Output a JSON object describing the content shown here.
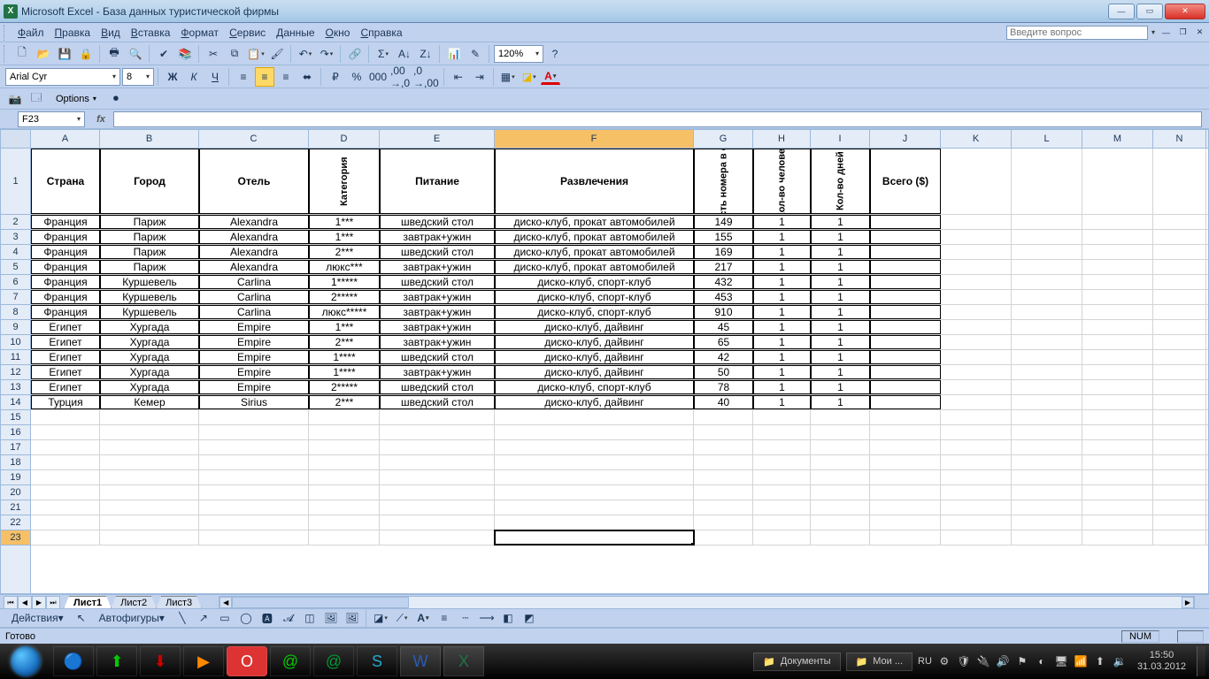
{
  "window": {
    "title": "Microsoft Excel - База данных туристической фирмы"
  },
  "menu": {
    "items": [
      "Файл",
      "Правка",
      "Вид",
      "Вставка",
      "Формат",
      "Сервис",
      "Данные",
      "Окно",
      "Справка"
    ],
    "ask_placeholder": "Введите вопрос"
  },
  "toolbar": {
    "zoom": "120%",
    "font_name": "Arial Cyr",
    "font_size": "8",
    "options_label": "Options"
  },
  "namebox": {
    "ref": "F23",
    "fx": "fx"
  },
  "columns": {
    "letters": [
      "A",
      "B",
      "C",
      "D",
      "E",
      "F",
      "G",
      "H",
      "I",
      "J",
      "K",
      "L",
      "M",
      "N"
    ],
    "widths": [
      78,
      112,
      124,
      80,
      130,
      225,
      67,
      65,
      67,
      80,
      80,
      80,
      80,
      60
    ],
    "selectedIndex": 5
  },
  "headers": [
    "Страна",
    "Город",
    "Отель",
    "Категория",
    "Питание",
    "Развлечения",
    "Стоимость номера в сутки ($)",
    "Кол-во человек",
    "Кол-во дней",
    "Всего ($)"
  ],
  "verticalHeaders": {
    "3": true,
    "6": true,
    "7": true,
    "8": true
  },
  "rows": [
    [
      "Франция",
      "Париж",
      "Alexandra",
      "1***",
      "шведский стол",
      "диско-клуб, прокат автомобилей",
      "149",
      "1",
      "1",
      ""
    ],
    [
      "Франция",
      "Париж",
      "Alexandra",
      "1***",
      "завтрак+ужин",
      "диско-клуб, прокат автомобилей",
      "155",
      "1",
      "1",
      ""
    ],
    [
      "Франция",
      "Париж",
      "Alexandra",
      "2***",
      "шведский стол",
      "диско-клуб, прокат автомобилей",
      "169",
      "1",
      "1",
      ""
    ],
    [
      "Франция",
      "Париж",
      "Alexandra",
      "люкс***",
      "завтрак+ужин",
      "диско-клуб, прокат автомобилей",
      "217",
      "1",
      "1",
      ""
    ],
    [
      "Франция",
      "Куршевель",
      "Carlina",
      "1*****",
      "шведский стол",
      "диско-клуб, спорт-клуб",
      "432",
      "1",
      "1",
      ""
    ],
    [
      "Франция",
      "Куршевель",
      "Carlina",
      "2*****",
      "завтрак+ужин",
      "диско-клуб, спорт-клуб",
      "453",
      "1",
      "1",
      ""
    ],
    [
      "Франция",
      "Куршевель",
      "Carlina",
      "люкс*****",
      "завтрак+ужин",
      "диско-клуб, спорт-клуб",
      "910",
      "1",
      "1",
      ""
    ],
    [
      "Египет",
      "Хургада",
      "Empire",
      "1***",
      "завтрак+ужин",
      "диско-клуб, дайвинг",
      "45",
      "1",
      "1",
      ""
    ],
    [
      "Египет",
      "Хургада",
      "Empire",
      "2***",
      "завтрак+ужин",
      "диско-клуб, дайвинг",
      "65",
      "1",
      "1",
      ""
    ],
    [
      "Египет",
      "Хургада",
      "Empire",
      "1****",
      "шведский стол",
      "диско-клуб, дайвинг",
      "42",
      "1",
      "1",
      ""
    ],
    [
      "Египет",
      "Хургада",
      "Empire",
      "1****",
      "завтрак+ужин",
      "диско-клуб, дайвинг",
      "50",
      "1",
      "1",
      ""
    ],
    [
      "Египет",
      "Хургада",
      "Empire",
      "2*****",
      "шведский стол",
      "диско-клуб, спорт-клуб",
      "78",
      "1",
      "1",
      ""
    ],
    [
      "Турция",
      "Кемер",
      "Sirius",
      "2***",
      "шведский стол",
      "диско-клуб, дайвинг",
      "40",
      "1",
      "1",
      ""
    ]
  ],
  "emptyRowsAfter": 9,
  "selection": {
    "row": 23,
    "colIndex": 5
  },
  "sheetTabs": {
    "tabs": [
      "Лист1",
      "Лист2",
      "Лист3"
    ],
    "active": 0
  },
  "drawbar": {
    "actions": "Действия",
    "autoshapes": "Автофигуры"
  },
  "status": {
    "ready": "Готово",
    "num": "NUM"
  },
  "taskbar": {
    "docs": "Документы",
    "my": "Мои ...",
    "lang": "RU",
    "time": "15:50",
    "date": "31.03.2012"
  },
  "icons": {
    "new": "🗋",
    "open": "📂",
    "save": "💾",
    "perm": "🔒",
    "print": "🖶",
    "preview": "🔍",
    "spell": "✔",
    "research": "📚",
    "cut": "✂",
    "copy": "⧉",
    "paste": "📋",
    "painter": "🖌",
    "undo": "↶",
    "redo": "↷",
    "link": "🔗",
    "sum": "Σ",
    "sortaz": "A↓",
    "sortza": "Z↓",
    "chart": "📊",
    "draw": "✎",
    "zoom": "🔎",
    "help": "?",
    "bold": "Ж",
    "italic": "К",
    "underline": "Ч",
    "al": "≡",
    "ac": "≡",
    "ar": "≡",
    "merge": "⬌",
    "currency": "₽",
    "percent": "%",
    "comma": ",0",
    "decinc": "←.0",
    "decdec": ".0→",
    "outdent": "⇤",
    "indent": "⇥",
    "borders": "▦",
    "fill": "◪",
    "fontcolor": "A",
    "line": "╲",
    "arrow": "↗",
    "rect": "▭",
    "oval": "◯",
    "textbox": "🅰",
    "wordart": "𝓐",
    "diagram": "◫",
    "clipart": "🖼",
    "pic": "🖼",
    "fillcolor": "◪",
    "linecolor": "⟋",
    "fontcolor2": "A",
    "linestyle": "≡",
    "dash": "┄",
    "arrowstyle": "⟶",
    "shadow": "◧",
    "3d": "◩",
    "ie": "🌐",
    "opera": "O",
    "mail": "@",
    "skype": "S",
    "word": "W",
    "xl": "X",
    "uarrow": "⬆",
    "darrow": "⬇",
    "play": "▶"
  }
}
